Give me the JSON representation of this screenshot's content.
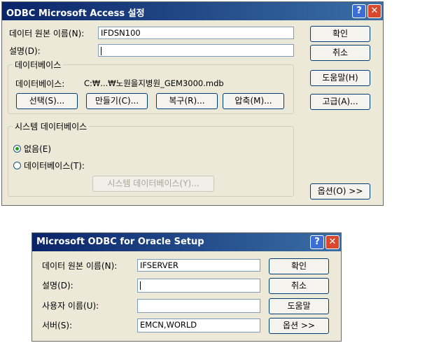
{
  "access_dialog": {
    "title": "ODBC Microsoft Access 설정",
    "help_glyph": "?",
    "close_glyph": "✕",
    "dsn_label": "데이터 원본 이름(N):",
    "dsn_value": "IFDSN100",
    "desc_label": "설명(D):",
    "desc_value": "",
    "db_group_title": "데이터베이스",
    "db_path_label": "데이터베이스:",
    "db_path_value": "C:₩...₩노원을지병원_GEM3000.mdb",
    "select_button": "선택(S)...",
    "create_button": "만들기(C)...",
    "repair_button": "복구(R)...",
    "compact_button": "압축(M)...",
    "sysdb_group_title": "시스템 데이터베이스",
    "radio_none_label": "없음(E)",
    "radio_db_label": "데이터베이스(T):",
    "sysdb_button": "시스템 데이터베이스(Y)...",
    "ok_button": "확인",
    "cancel_button": "취소",
    "help_button": "도움말(H)",
    "advanced_button": "고급(A)...",
    "options_button": "옵션(O) >>"
  },
  "oracle_dialog": {
    "title": "Microsoft ODBC for Oracle Setup",
    "help_glyph": "?",
    "close_glyph": "✕",
    "dsn_label": "데이터 원본 이름(N):",
    "dsn_value": "IFSERVER",
    "desc_label": "설명(D):",
    "desc_value": "",
    "user_label": "사용자 이름(U):",
    "user_value": "",
    "server_label": "서버(S):",
    "server_value": "EMCN,WORLD",
    "ok_button": "확인",
    "cancel_button": "취소",
    "help_button": "도움말",
    "options_button": "옵션 >>"
  },
  "colors": {
    "titlebar_start": "#0a246a",
    "titlebar_end": "#3a6ea5",
    "dialog_bg": "#ece9d8"
  }
}
